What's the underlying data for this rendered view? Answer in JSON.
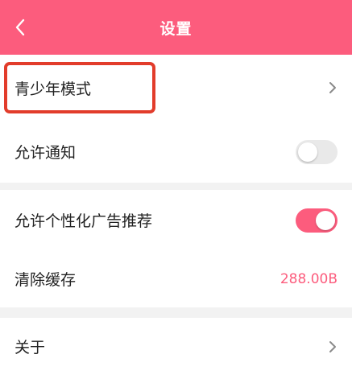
{
  "header": {
    "title": "设置",
    "back_icon": "chevron-left-icon"
  },
  "rows": {
    "youth_mode": {
      "label": "青少年模式"
    },
    "allow_notify": {
      "label": "允许通知",
      "enabled": false
    },
    "personalized_ads": {
      "label": "允许个性化广告推荐",
      "enabled": true
    },
    "clear_cache": {
      "label": "清除缓存",
      "value": "288.00B"
    },
    "about": {
      "label": "关于"
    }
  },
  "colors": {
    "accent": "#fc5c7d",
    "highlight": "#e23c2b",
    "background": "#f2f2f2"
  }
}
